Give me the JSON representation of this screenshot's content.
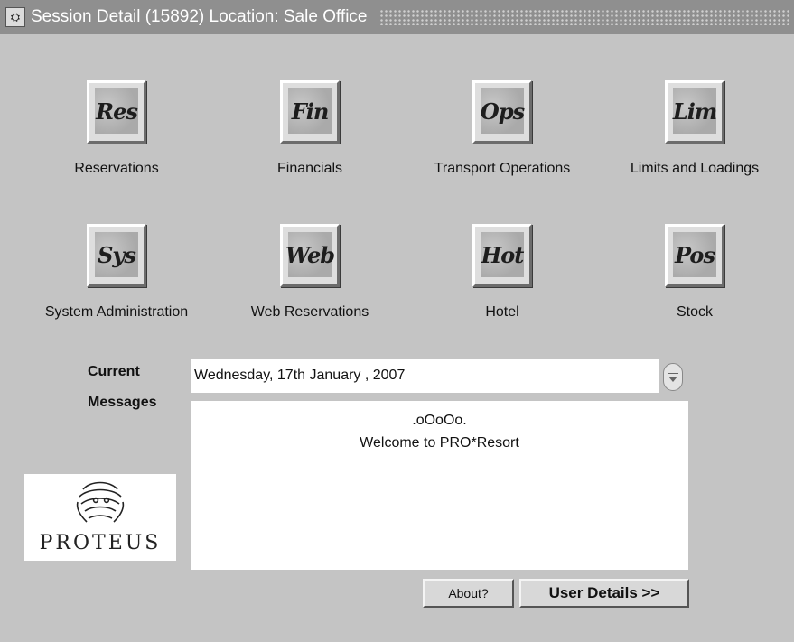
{
  "window": {
    "title": "Session Detail (15892) Location: Sale Office",
    "icon": "app-window-icon"
  },
  "modules": [
    {
      "code": "Res",
      "label": "Reservations"
    },
    {
      "code": "Fin",
      "label": "Financials"
    },
    {
      "code": "Ops",
      "label": "Transport Operations"
    },
    {
      "code": "Lim",
      "label": "Limits and Loadings"
    },
    {
      "code": "Sys",
      "label": "System Administration"
    },
    {
      "code": "Web",
      "label": "Web Reservations"
    },
    {
      "code": "Hot",
      "label": "Hotel"
    },
    {
      "code": "Pos",
      "label": "Stock"
    }
  ],
  "form": {
    "current_label": "Current",
    "current_value": "Wednesday, 17th January  , 2007",
    "messages_label": "Messages",
    "messages": [
      ".oOoOo.",
      "Welcome to PRO*Resort"
    ]
  },
  "logo": {
    "text": "PROTEUS"
  },
  "buttons": {
    "about": "About?",
    "user_details": "User Details >>"
  },
  "colors": {
    "background": "#c4c4c4",
    "titlebar": "#8f8f8f",
    "field": "#ffffff"
  }
}
